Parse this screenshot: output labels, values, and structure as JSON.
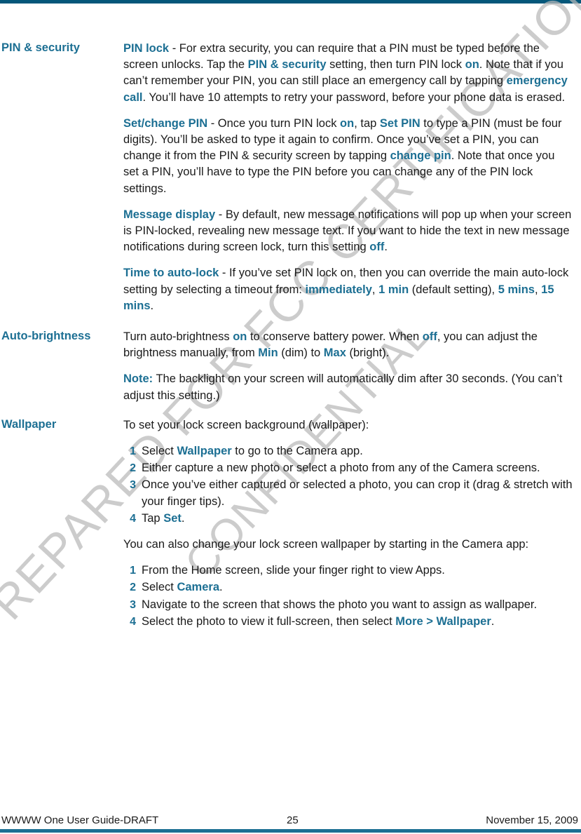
{
  "page": {
    "accent_color": "#1c6f93",
    "rule_color": "#04577a",
    "body_color": "#1a1a1a"
  },
  "watermark": {
    "line1": "PREPARED FOR FCC CERTIFICATION",
    "line2": "CONFIDENTIAL"
  },
  "sections": [
    {
      "term": "PIN & security",
      "paragraphs": [
        {
          "runs": [
            {
              "t": "PIN lock",
              "hl": true
            },
            {
              "t": " - For extra security, you can require that a PIN must be typed before the screen unlocks. Tap the "
            },
            {
              "t": "PIN & security",
              "hl": true
            },
            {
              "t": " setting, then turn PIN lock "
            },
            {
              "t": "on",
              "hl": true
            },
            {
              "t": ". Note that if you can’t remember your PIN, you can still place an emergency call by tapping "
            },
            {
              "t": "emergency call",
              "hl": true
            },
            {
              "t": ". You’ll have 10 attempts to retry your password, before your phone data is erased."
            }
          ]
        },
        {
          "runs": [
            {
              "t": "Set/change PIN",
              "hl": true
            },
            {
              "t": " - Once you turn PIN lock "
            },
            {
              "t": "on",
              "hl": true
            },
            {
              "t": ", tap "
            },
            {
              "t": "Set PIN",
              "hl": true
            },
            {
              "t": " to type a PIN (must be four digits). You’ll be asked to type it again to confirm. Once you’ve set a PIN, you can change it from the PIN & security screen by tapping "
            },
            {
              "t": "change pin",
              "hl": true
            },
            {
              "t": ". Note that once you set a PIN, you’ll have to type the PIN before you can change any of the PIN lock settings."
            }
          ]
        },
        {
          "runs": [
            {
              "t": "Message display",
              "hl": true
            },
            {
              "t": " - By default, new message notifications will pop up when your screen is PIN-locked, revealing new message text. If you want to hide the text in new message notifications during screen lock, turn this setting "
            },
            {
              "t": "off",
              "hl": true
            },
            {
              "t": "."
            }
          ]
        },
        {
          "runs": [
            {
              "t": "Time to auto-lock",
              "hl": true
            },
            {
              "t": " - If you’ve set PIN lock on, then you can override the main auto-lock setting by selecting a timeout from: "
            },
            {
              "t": "immediately",
              "hl": true
            },
            {
              "t": ", "
            },
            {
              "t": "1 min",
              "hl": true
            },
            {
              "t": " (default setting), "
            },
            {
              "t": "5 mins",
              "hl": true
            },
            {
              "t": ", "
            },
            {
              "t": "15 mins",
              "hl": true
            },
            {
              "t": "."
            }
          ]
        }
      ]
    },
    {
      "term": "Auto-brightness",
      "paragraphs": [
        {
          "runs": [
            {
              "t": "Turn auto-brightness "
            },
            {
              "t": "on",
              "hl": true
            },
            {
              "t": " to conserve battery power. When "
            },
            {
              "t": "off",
              "hl": true
            },
            {
              "t": ", you can adjust the brightness manually, from "
            },
            {
              "t": "Min",
              "hl": true
            },
            {
              "t": " (dim) to "
            },
            {
              "t": "Max",
              "hl": true
            },
            {
              "t": " (bright)."
            }
          ]
        },
        {
          "runs": [
            {
              "t": "Note:",
              "hl": true
            },
            {
              "t": " The backlight on your screen will automatically dim after 30 seconds. (You can’t adjust this setting.)"
            }
          ]
        }
      ]
    },
    {
      "term": "Wallpaper",
      "paragraphs": [
        {
          "runs": [
            {
              "t": "To set your lock screen background (wallpaper):"
            }
          ]
        }
      ],
      "list1": [
        {
          "num": "1",
          "runs": [
            {
              "t": "Select "
            },
            {
              "t": "Wallpaper",
              "hl": true
            },
            {
              "t": " to go to the Camera app."
            }
          ]
        },
        {
          "num": "2",
          "runs": [
            {
              "t": "Either capture a new photo or select a photo from any of the Camera screens."
            }
          ]
        },
        {
          "num": "3",
          "runs": [
            {
              "t": "Once you’ve either captured or selected a photo, you can crop it (drag & stretch with your finger tips)."
            }
          ]
        },
        {
          "num": "4",
          "runs": [
            {
              "t": "Tap "
            },
            {
              "t": "Set",
              "hl": true
            },
            {
              "t": "."
            }
          ]
        }
      ],
      "paragraphs2": [
        {
          "runs": [
            {
              "t": "You can also change your lock screen wallpaper by starting in the Camera app:"
            }
          ]
        }
      ],
      "list2": [
        {
          "num": "1",
          "runs": [
            {
              "t": "From the Home screen, slide your finger right to view Apps."
            }
          ]
        },
        {
          "num": "2",
          "runs": [
            {
              "t": "Select "
            },
            {
              "t": "Camera",
              "hl": true
            },
            {
              "t": "."
            }
          ]
        },
        {
          "num": "3",
          "runs": [
            {
              "t": "Navigate to the screen that shows the photo you want to assign as wallpaper."
            }
          ]
        },
        {
          "num": "4",
          "runs": [
            {
              "t": "Select the photo to view it full-screen, then select "
            },
            {
              "t": "More > Wallpaper",
              "hl": true
            },
            {
              "t": "."
            }
          ]
        }
      ]
    }
  ],
  "footer": {
    "left": "WWWW One User Guide-DRAFT",
    "page_number": "25",
    "right": "November 15, 2009"
  }
}
